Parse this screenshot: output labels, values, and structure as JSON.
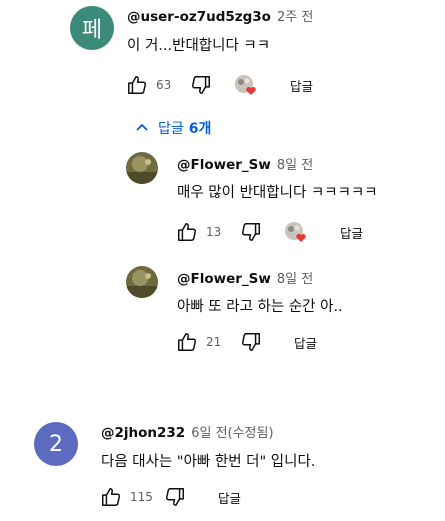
{
  "comments": [
    {
      "avatar_letter": "페",
      "avatar_color": "#3c8a79",
      "author": "@user-oz7ud5zg3o",
      "time": "2주 전",
      "text": "이 거...반대합니다 ㅋㅋ",
      "likes": "63",
      "reply_label": "답글",
      "creator_hearted": true
    },
    {
      "avatar_letter": "2",
      "avatar_color": "#5c6bc0",
      "author": "@2jhon232",
      "time": "6일 전(수정됨)",
      "text": "다음 대사는 \"아빠 한번 더\" 입니다.",
      "likes": "115",
      "reply_label": "답글",
      "creator_hearted": false
    }
  ],
  "replies_toggle": {
    "label": "답글",
    "count": "6개",
    "icon": "chevron-up-icon"
  },
  "replies": [
    {
      "author": "@Flower_Sw",
      "time": "8일 전",
      "text": "매우 많이 반대합니다 ㅋㅋㅋㅋㅋ",
      "likes": "13",
      "reply_label": "답글",
      "creator_hearted": true
    },
    {
      "author": "@Flower_Sw",
      "time": "8일 전",
      "text": "아빠 또 라고 하는 순간 아..",
      "likes": "21",
      "reply_label": "답글",
      "creator_hearted": false
    }
  ],
  "colors": {
    "link_blue": "#065fd4",
    "heart_red": "#e53935",
    "icon_gray": "#0f0f0f"
  }
}
